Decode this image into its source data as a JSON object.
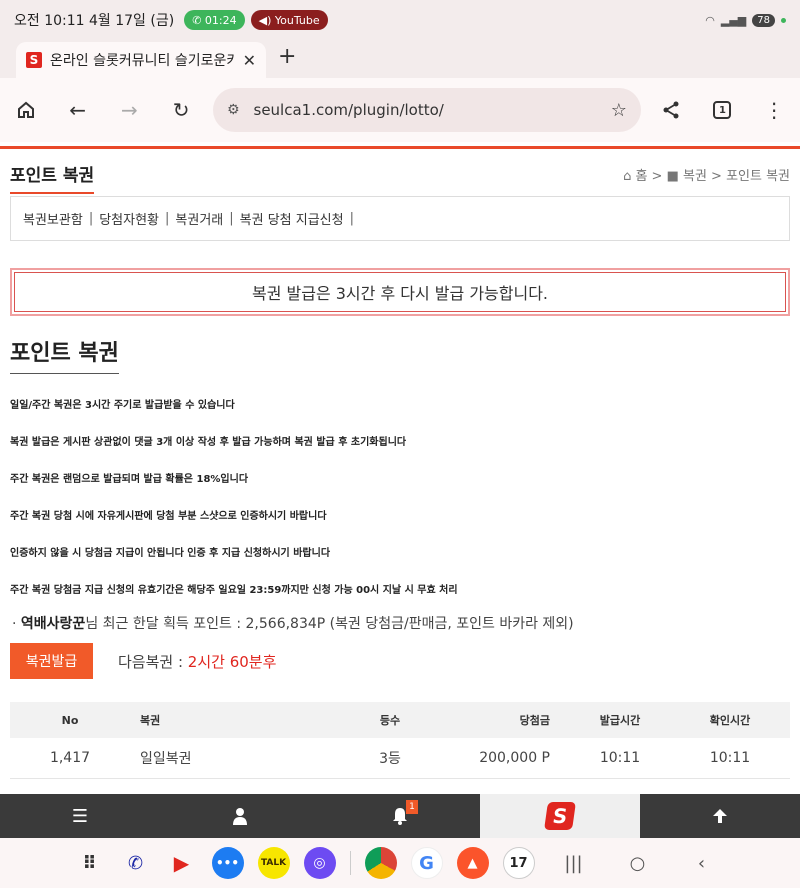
{
  "status": {
    "time": "오전 10:11  4월 17일 (금)",
    "call": "01:24",
    "youtube": "YouTube",
    "battery": "78"
  },
  "browser": {
    "tab_title": "온라인 슬롯커뮤니티 슬기로운카",
    "url": "seulca1.com/plugin/lotto/",
    "tab_count": "1"
  },
  "page": {
    "heading": "포인트 복권",
    "breadcrumb": "홈 > ■ 복권 > 포인트 복권",
    "subnav": [
      "복권보관함",
      "당첨자현황",
      "복권거래",
      "복권 당첨 지급신청"
    ],
    "notice": "복권 발급은 3시간 후 다시 발급 가능합니다.",
    "title": "포인트 복권",
    "rules": [
      "일일/주간 복권은 3시간 주기로 발급받을 수 있습니다",
      "복권 발급은 게시판 상관없이 댓글 3개 이상 작성 후 발급 가능하며 복권 발급 후 초기화됩니다",
      "주간 복권은 랜덤으로 발급되며 발급 확률은 18%입니다",
      "주간 복권 당첨 시에 자유게시판에 당첨 부분 스샷으로 인증하시기 바랍니다",
      "인증하지 않을 시 당첨금 지급이 안됩니다 인증 후 지급 신청하시기 바랍니다",
      "주간 복권 당첨금 지급 신청의 유효기간은 해당주 일요일 23:59까지만 신청 가능 00시 지날 시 무효 처리"
    ],
    "user_name": "역배사랑꾼",
    "stat_text": "님 최근 한달 획득 포인트 : 2,566,834P (복권 당첨금/판매금, 포인트 바카라 제외)",
    "issue_button": "복권발급",
    "next_label": "다음복권 : ",
    "next_value": "2시간 60분후"
  },
  "table": {
    "headers": [
      "No",
      "복권",
      "등수",
      "당첨금",
      "발급시간",
      "확인시간"
    ],
    "rows": [
      [
        "1,417",
        "일일복권",
        "3등",
        "200,000 P",
        "10:11",
        "10:11"
      ]
    ]
  },
  "sitebar": {
    "notification_count": "1"
  },
  "dock": {
    "talk_label": "TALK",
    "calendar_day": "17"
  }
}
